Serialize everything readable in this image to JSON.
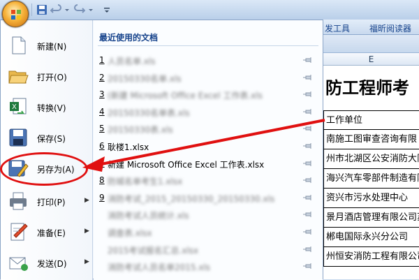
{
  "ribbon": {
    "tabs": [
      "发工具",
      "福昕阅读器"
    ]
  },
  "sheet": {
    "column_header": "E",
    "title": "防工程师考",
    "field_header": "工作单位",
    "rows": [
      "南施工图审查咨询有限",
      "州市北湖区公安消防大队",
      "海兴汽车零部件制造有限",
      "资兴市污水处理中心",
      "景月酒店管理有限公司苏",
      "郴电国际永兴分公司",
      "州恒安消防工程有限公司"
    ]
  },
  "menu": {
    "items": [
      {
        "label": "新建(N)",
        "icon": "new-document-icon"
      },
      {
        "label": "打开(O)",
        "icon": "open-folder-icon"
      },
      {
        "label": "转换(V)",
        "icon": "convert-icon"
      },
      {
        "label": "保存(S)",
        "icon": "save-floppy-icon"
      },
      {
        "label": "另存为(A)",
        "icon": "save-as-icon"
      },
      {
        "label": "打印(P)",
        "icon": "print-icon"
      },
      {
        "label": "准备(E)",
        "icon": "prepare-icon"
      },
      {
        "label": "发送(D)",
        "icon": "send-icon"
      }
    ]
  },
  "recent": {
    "header": "最近使用的文档",
    "files": [
      {
        "num": "1",
        "name": "人员名单.xls",
        "blurred": true
      },
      {
        "num": "2",
        "name": "20150330名单.xls",
        "blurred": true
      },
      {
        "num": "3",
        "name": "(新建 Microsoft Office Excel 工作表.xls",
        "blurred": true
      },
      {
        "num": "4",
        "name": "20150330名单表.xls",
        "blurred": true
      },
      {
        "num": "5",
        "name": "20150330表.xls",
        "blurred": true
      },
      {
        "num": "6",
        "name": "耿楼1.xlsx",
        "blurred": false
      },
      {
        "num": "7",
        "name": "新建 Microsoft Office Excel 工作表.xlsx",
        "blurred": false
      },
      {
        "num": "8",
        "name": "防城名单考生1.xlsx",
        "blurred": true
      },
      {
        "num": "9",
        "name": "消防考试_2015_20150330_20150330.xls",
        "blurred": true
      },
      {
        "num": "",
        "name": "消防考试人员统计.xls",
        "blurred": true
      },
      {
        "num": "",
        "name": "调查表.xlsx",
        "blurred": true
      },
      {
        "num": "",
        "name": "2015考试报名汇总.xlsx",
        "blurred": true
      },
      {
        "num": "",
        "name": "消防考试人员名单2015.xls",
        "blurred": true
      }
    ]
  },
  "colors": {
    "highlight": "#e01010",
    "accent": "#15428b"
  }
}
